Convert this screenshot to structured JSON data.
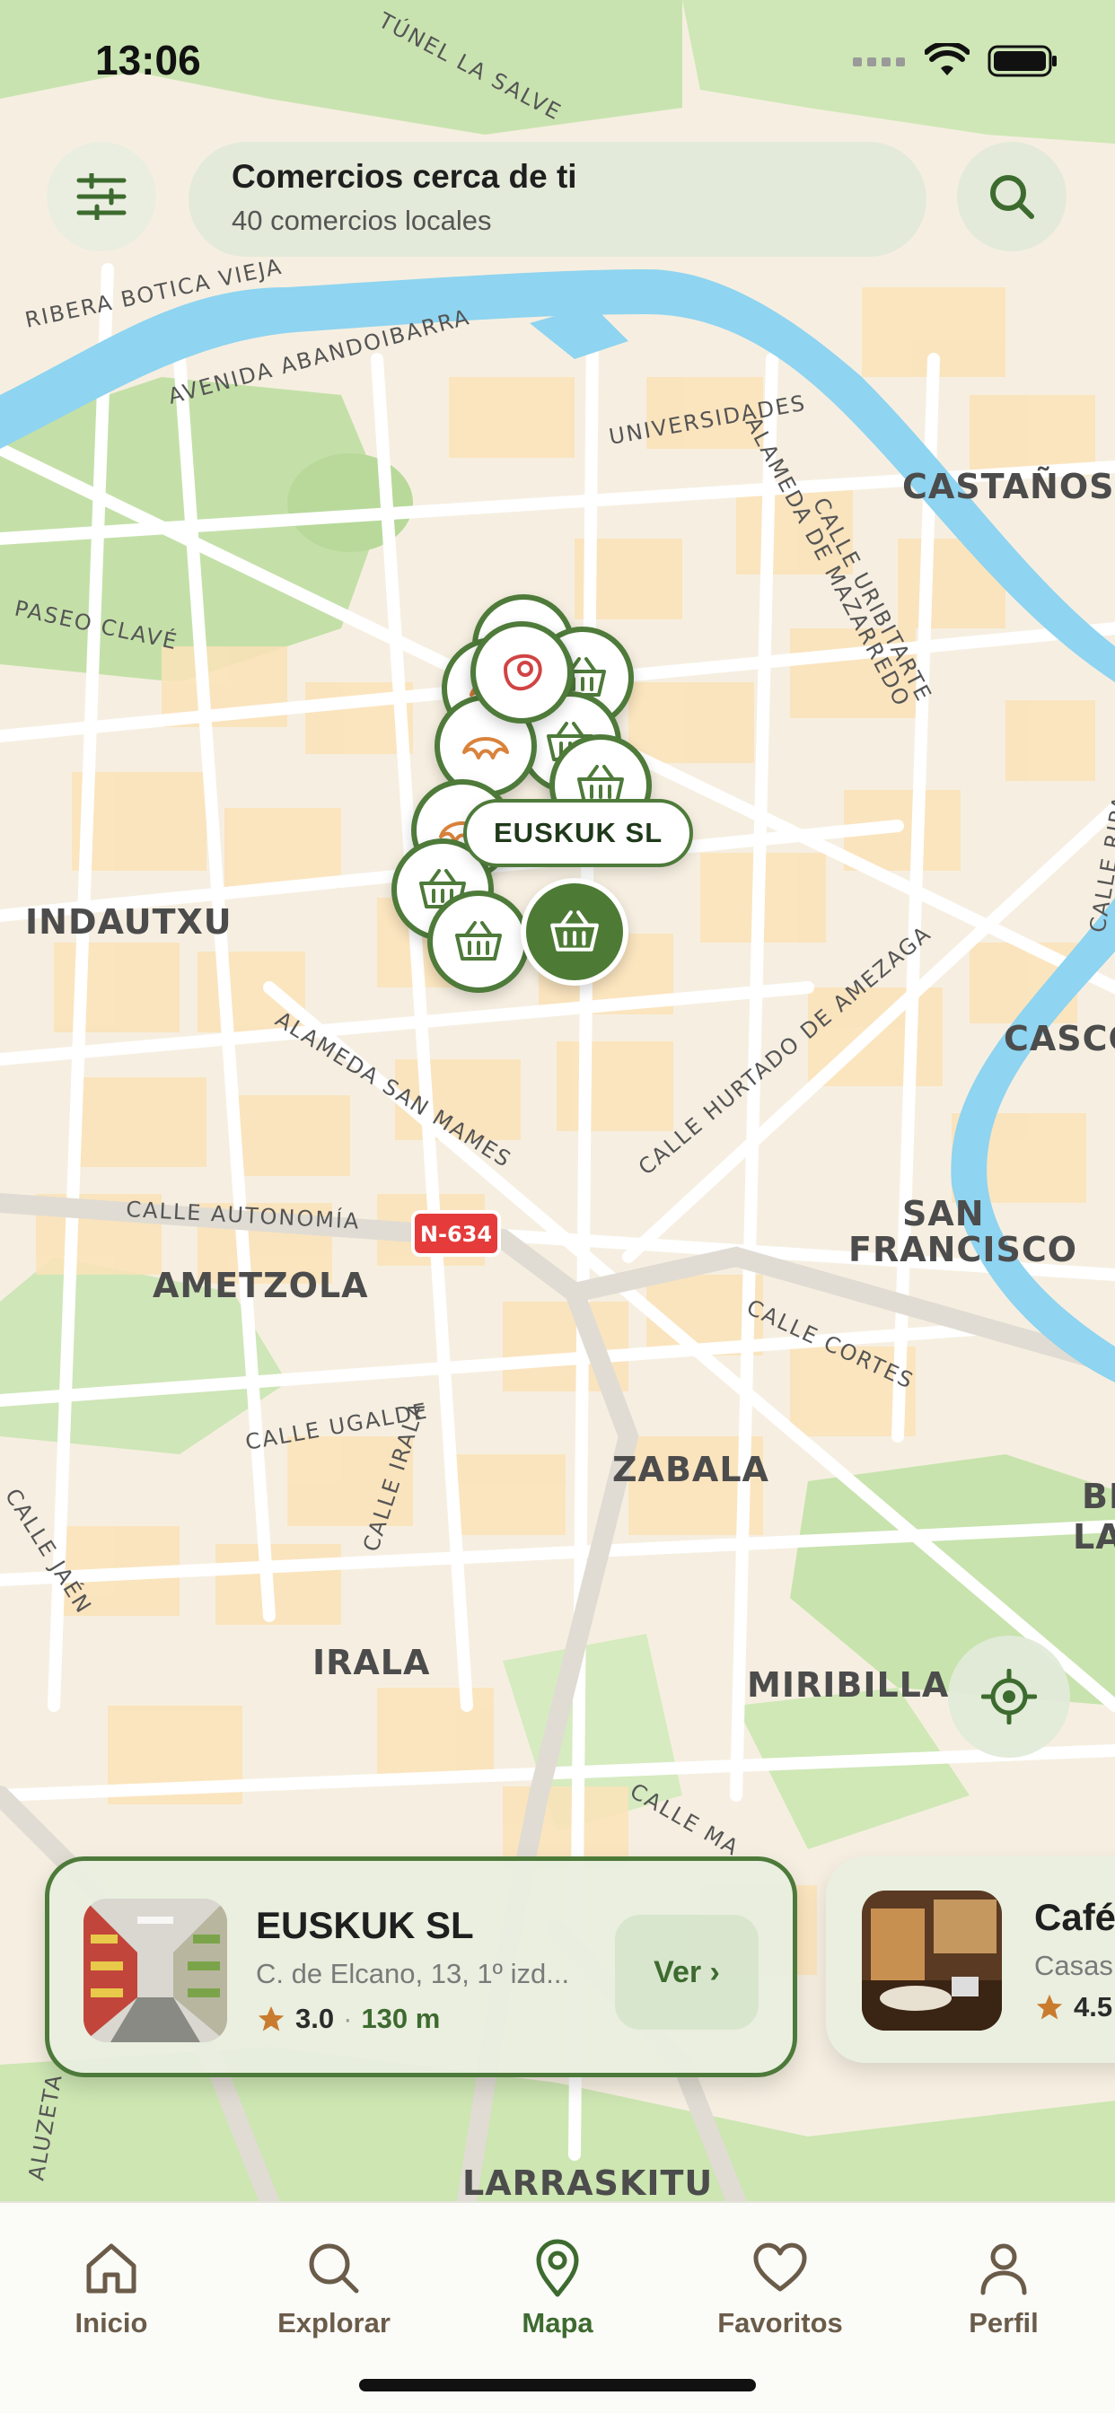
{
  "status_bar": {
    "time": "13:06"
  },
  "header": {
    "title": "Comercios cerca de ti",
    "subtitle": "40 comercios locales"
  },
  "map": {
    "streets": [
      "TÚNEL LA SALVE",
      "RIBERA BOTICA VIEJA",
      "AVENIDA ABANDOIBARRA",
      "ALAMEDA DE MAZARREDO",
      "CALLE URIBITARTE",
      "PASEO CLAVÉ",
      "ALAMEDA SAN MAMES",
      "CALLE HURTADO DE AMEZAGA",
      "CALLE AUTONOMÍA",
      "CALLE CORTES",
      "CALLE UGALDE",
      "CALLE IRALA",
      "CALLE JAÉN",
      "CALLE RIPA",
      "UNIVERSIDADES",
      "CALLE MA",
      "ALUZETA"
    ],
    "districts": [
      "CASTAÑOS",
      "INDAUTXU",
      "CASCO",
      "SAN",
      "FRANCISCO",
      "AMETZOLA",
      "ZABALA",
      "IRALA",
      "MIRIBILLA",
      "LARRASKITU",
      "BI",
      "LA"
    ],
    "road_badge": "N-634",
    "selected_marker_label": "EUSKUK SL"
  },
  "cards": [
    {
      "name": "EUSKUK SL",
      "address": "C. de Elcano, 13, 1º izd...",
      "rating": "3.0",
      "distance": "130 m",
      "button": "Ver ›"
    },
    {
      "name": "Café",
      "address": "Casas",
      "rating": "4.5"
    }
  ],
  "tabs": [
    {
      "label": "Inicio",
      "icon": "home-icon"
    },
    {
      "label": "Explorar",
      "icon": "search-icon"
    },
    {
      "label": "Mapa",
      "icon": "map-pin-icon",
      "active": true
    },
    {
      "label": "Favoritos",
      "icon": "heart-icon"
    },
    {
      "label": "Perfil",
      "icon": "person-icon"
    }
  ],
  "colors": {
    "accent": "#4d7b35",
    "river": "#8fd4f0",
    "tab_inactive": "#6b5c4a"
  }
}
